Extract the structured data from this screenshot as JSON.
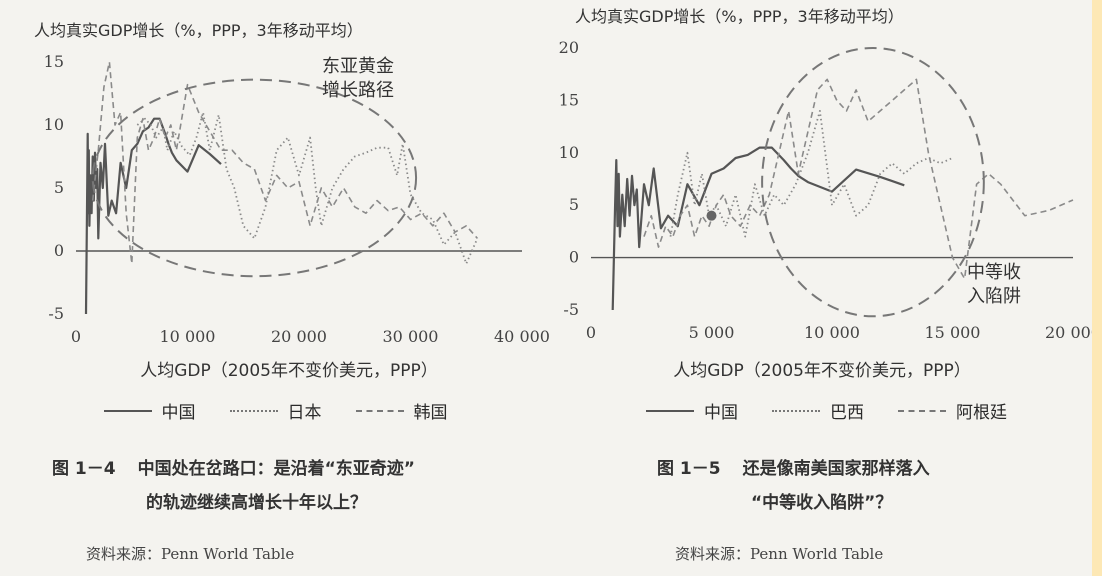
{
  "chart_data": [
    {
      "type": "line",
      "title": "",
      "ylabel": "人均真实GDP增长（%，PPP，3年移动平均）",
      "xlabel": "人均GDP（2005年不变价美元，PPP）",
      "xlim": [
        0,
        40000
      ],
      "ylim": [
        -5,
        15
      ],
      "xticks": [
        0,
        10000,
        20000,
        30000,
        40000
      ],
      "xtick_labels": [
        "0",
        "10 000",
        "20 000",
        "30 000",
        "40 000"
      ],
      "yticks": [
        -5,
        0,
        5,
        10,
        15
      ],
      "ytick_labels": [
        "-5",
        "0",
        "5",
        "10",
        "15"
      ],
      "annotation": "东亚黄金\n增长路径",
      "ellipse": {
        "cx": 16000,
        "cy": 5.8,
        "rx": 14500,
        "ry": 7.8
      },
      "series": [
        {
          "name": "中国",
          "style": "solid",
          "x": [
            900,
            1000,
            1050,
            1100,
            1150,
            1200,
            1300,
            1400,
            1500,
            1600,
            1700,
            1800,
            1900,
            2000,
            2200,
            2400,
            2600,
            2900,
            3200,
            3600,
            4000,
            4500,
            5000,
            5500,
            6000,
            6500,
            7000,
            7500,
            8000,
            8300,
            8600,
            9000,
            10000,
            11000,
            12000,
            13000
          ],
          "y": [
            -5,
            5,
            9.3,
            3,
            8,
            2,
            6,
            3,
            7.5,
            4,
            7.8,
            5,
            6.5,
            1,
            7,
            5,
            8.5,
            2.8,
            4,
            3,
            7,
            5,
            8,
            8.5,
            9.5,
            9.8,
            10.5,
            10.5,
            9.3,
            8.5,
            7.8,
            7.2,
            6.3,
            8.4,
            7.7,
            6.9
          ]
        },
        {
          "name": "日本",
          "style": "dotted",
          "x": [
            5500,
            6200,
            6700,
            7200,
            7800,
            8200,
            8800,
            9500,
            10200,
            10800,
            11400,
            12000,
            12800,
            13500,
            14200,
            15000,
            16000,
            17000,
            18000,
            19000,
            20000,
            21000,
            21500,
            22000,
            23000,
            24000,
            25000,
            26000,
            27000,
            28000,
            28800,
            29300,
            30000,
            31000,
            32000,
            33000,
            34000,
            35000,
            36000
          ],
          "y": [
            10,
            10.5,
            10,
            9,
            9.8,
            8,
            9.5,
            8.3,
            7.6,
            9,
            11,
            8,
            10.8,
            6.5,
            5,
            2,
            1,
            3.5,
            8,
            9,
            6,
            9,
            5,
            2,
            5,
            6.5,
            7.5,
            7.8,
            8.2,
            8.2,
            6,
            8.5,
            4.5,
            3,
            2.5,
            0.5,
            1.5,
            -1,
            1
          ]
        },
        {
          "name": "韩国",
          "style": "dashed",
          "x": [
            1500,
            2000,
            2500,
            3000,
            3500,
            4000,
            4500,
            5000,
            5500,
            6000,
            6500,
            7000,
            7500,
            8000,
            8500,
            9000,
            10000,
            11000,
            12000,
            13000,
            14000,
            15000,
            16000,
            17000,
            18000,
            19000,
            20000,
            21000,
            22000,
            23000,
            24000,
            25000,
            26000,
            27000,
            28000,
            29000,
            30000,
            31000,
            32000,
            33000,
            34000,
            35000,
            36000
          ],
          "y": [
            4,
            8,
            13,
            15,
            10,
            11,
            3,
            -1,
            9,
            10.5,
            8,
            9,
            10.5,
            9,
            10,
            8,
            13.2,
            11,
            9.5,
            8,
            8,
            7,
            6.5,
            4,
            6,
            5,
            5.5,
            2,
            5,
            3.5,
            5,
            3.5,
            3,
            4,
            3.2,
            3.5,
            2.5,
            3,
            2,
            3,
            1.5,
            2,
            1
          ]
        }
      ]
    },
    {
      "type": "line",
      "title": "",
      "ylabel": "人均真实GDP增长（%，PPP，3年移动平均）",
      "xlabel": "人均GDP（2005年不变价美元，PPP）",
      "xlim": [
        0,
        20000
      ],
      "ylim": [
        -5,
        20
      ],
      "xticks": [
        0,
        5000,
        10000,
        15000,
        20000
      ],
      "xtick_labels": [
        "0",
        "5 000",
        "10 000",
        "15 000",
        "20 000"
      ],
      "yticks": [
        -5,
        0,
        5,
        10,
        15,
        20
      ],
      "ytick_labels": [
        "-5",
        "0",
        "5",
        "10",
        "15",
        "20"
      ],
      "annotation": "中等收\n入陷阱",
      "ellipse": {
        "cx": 11700,
        "cy": 7.2,
        "rx": 4600,
        "ry": 12.8
      },
      "point": {
        "x": 5000,
        "y": 4
      },
      "series": [
        {
          "name": "中国",
          "style": "solid",
          "x": [
            900,
            1000,
            1050,
            1100,
            1150,
            1200,
            1300,
            1400,
            1500,
            1600,
            1700,
            1800,
            1900,
            2000,
            2200,
            2400,
            2600,
            2900,
            3200,
            3600,
            4000,
            4500,
            5000,
            5500,
            6000,
            6500,
            7000,
            7500,
            8000,
            8300,
            8600,
            9000,
            10000,
            11000,
            12000,
            13000
          ],
          "y": [
            -5,
            5,
            9.3,
            3,
            8,
            2,
            6,
            3,
            7.5,
            4,
            7.8,
            5,
            6.5,
            1,
            7,
            5,
            8.5,
            2.8,
            4,
            3,
            7,
            5,
            8,
            8.5,
            9.5,
            9.8,
            10.5,
            10.5,
            9.3,
            8.5,
            7.8,
            7.2,
            6.3,
            8.4,
            7.7,
            6.9
          ]
        },
        {
          "name": "巴西",
          "style": "dotted",
          "x": [
            3300,
            3600,
            4000,
            4300,
            4600,
            4900,
            5200,
            5600,
            6000,
            6400,
            6800,
            7200,
            7600,
            8000,
            8500,
            9000,
            9500,
            10000,
            10500,
            11000,
            11500,
            12000,
            12500,
            13000,
            13500,
            14000,
            14500,
            15000
          ],
          "y": [
            2,
            6,
            10,
            5,
            8,
            4,
            5,
            3,
            6,
            2,
            7,
            4,
            6,
            5,
            7,
            10,
            14,
            5,
            7,
            4,
            5,
            8,
            9,
            8,
            9,
            9.5,
            9,
            9.5
          ]
        },
        {
          "name": "阿根廷",
          "style": "dashed",
          "x": [
            2200,
            2500,
            2800,
            3100,
            3400,
            3700,
            4000,
            4300,
            4600,
            4900,
            5200,
            5500,
            5800,
            6200,
            6600,
            7000,
            7400,
            7800,
            8200,
            8600,
            9000,
            9400,
            9800,
            10200,
            10600,
            11000,
            11500,
            12000,
            12500,
            13000,
            13500,
            14000,
            14500,
            15000,
            15500,
            16000,
            16500,
            17000,
            18000,
            19000,
            20000
          ],
          "y": [
            2,
            4,
            1,
            3,
            2,
            4,
            5,
            2,
            4,
            3,
            5,
            6,
            4,
            3,
            5,
            4,
            6,
            10,
            14,
            8,
            12,
            16,
            17,
            15,
            14,
            16,
            13,
            14,
            15,
            16,
            17,
            10,
            5,
            0,
            -2,
            7,
            8,
            7,
            4,
            4.5,
            5.5
          ]
        }
      ]
    }
  ],
  "figures": [
    {
      "legend": [
        "中国",
        "日本",
        "韩国"
      ],
      "caption_number": "图 1－4",
      "caption_lines": [
        "中国处在岔路口：是沿着“东亚奇迹”",
        "的轨迹继续高增长十年以上？"
      ],
      "source": "资料来源：Penn World Table"
    },
    {
      "legend": [
        "中国",
        "巴西",
        "阿根廷"
      ],
      "caption_number": "图 1－5",
      "caption_lines": [
        "还是像南美国家那样落入",
        "“中等收入陷阱”？"
      ],
      "source": "资料来源：Penn World Table"
    }
  ]
}
